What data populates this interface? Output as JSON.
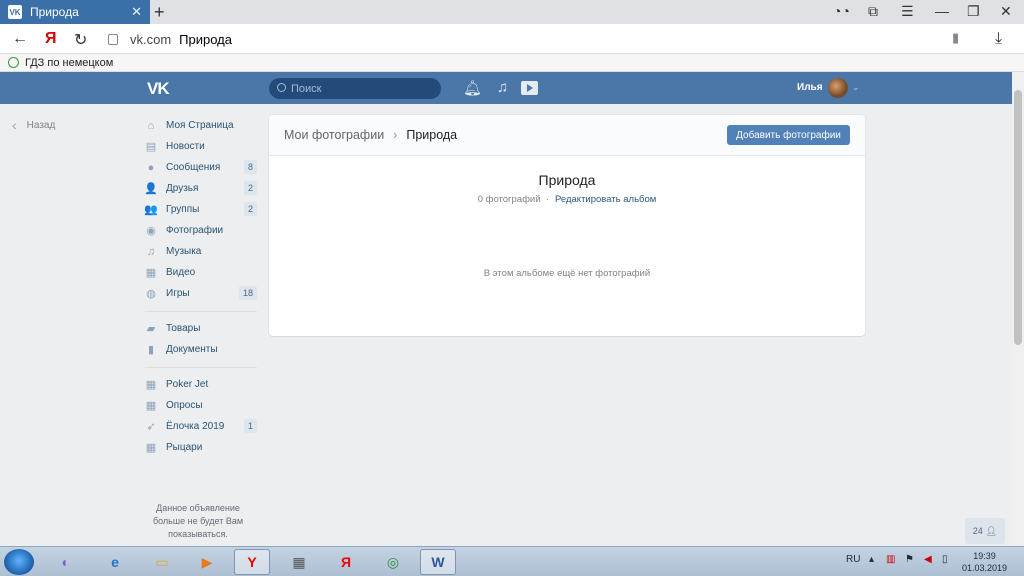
{
  "browser": {
    "tab_title": "Природа",
    "tab_favicon": "VK",
    "url_domain": "vk.com",
    "url_page": "Природа",
    "bookmark_label": "ГДЗ по немецком"
  },
  "header": {
    "logo": "VK",
    "search_placeholder": "Поиск",
    "user_name": "Илья"
  },
  "back_label": "Назад",
  "sidebar": {
    "items": [
      {
        "label": "Моя Страница",
        "icon": "home-icon",
        "glyph": "⌂",
        "count": ""
      },
      {
        "label": "Новости",
        "icon": "news-icon",
        "glyph": "▤",
        "count": ""
      },
      {
        "label": "Сообщения",
        "icon": "messages-icon",
        "glyph": "●",
        "count": "8"
      },
      {
        "label": "Друзья",
        "icon": "friends-icon",
        "glyph": "👤",
        "count": "2"
      },
      {
        "label": "Группы",
        "icon": "groups-icon",
        "glyph": "👥",
        "count": "2"
      },
      {
        "label": "Фотографии",
        "icon": "camera-icon",
        "glyph": "◉",
        "count": ""
      },
      {
        "label": "Музыка",
        "icon": "music-icon",
        "glyph": "♫",
        "count": ""
      },
      {
        "label": "Видео",
        "icon": "video-icon",
        "glyph": "▦",
        "count": ""
      },
      {
        "label": "Игры",
        "icon": "gamepad-icon",
        "glyph": "◍",
        "count": "18"
      }
    ],
    "items2": [
      {
        "label": "Товары",
        "icon": "bag-icon",
        "glyph": "▰"
      },
      {
        "label": "Документы",
        "icon": "document-icon",
        "glyph": "▮"
      }
    ],
    "items3": [
      {
        "label": "Poker Jet",
        "icon": "app-grid-icon",
        "glyph": "▦",
        "count": ""
      },
      {
        "label": "Опросы",
        "icon": "app-grid-icon",
        "glyph": "▦",
        "count": ""
      },
      {
        "label": "Ёлочка 2019",
        "icon": "rocket-icon",
        "glyph": "➶",
        "count": "1"
      },
      {
        "label": "Рыцари",
        "icon": "app-grid-icon",
        "glyph": "▦",
        "count": ""
      }
    ],
    "ad_notice": "Данное объявление больше не будет Вам показываться."
  },
  "main": {
    "breadcrumb_root": "Мои фотографии",
    "breadcrumb_sep": "›",
    "breadcrumb_current": "Природа",
    "add_button": "Добавить фотографии",
    "album_title": "Природа",
    "photo_count": "0 фотографий",
    "meta_dot": "·",
    "edit_link": "Редактировать альбом",
    "empty_text": "В этом альбоме ещё нет фотографий"
  },
  "online_badge": "24",
  "taskbar": {
    "lang": "RU",
    "time": "19:39",
    "date": "01.03.2019"
  },
  "colors": {
    "vk_header": "#4a76a8",
    "accent_button": "#5181b8",
    "link": "#2a5885"
  }
}
